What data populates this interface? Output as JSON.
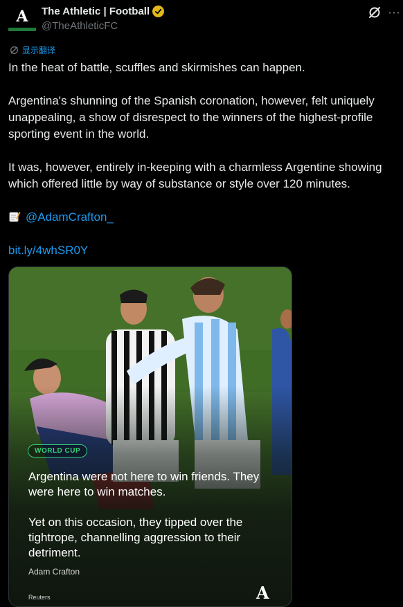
{
  "header": {
    "avatar_glyph": "A",
    "display_name": "The Athletic | Football",
    "handle": "@TheAthleticFC",
    "brand_green": "#1f7a3a",
    "verified_color": "#e2b719"
  },
  "translate": {
    "icon": "translate-icon",
    "label": "显示翻译"
  },
  "tweet": {
    "p1": "In the heat of battle, scuffles and skirmishes can happen.",
    "p2": "Argentina's shunning of the Spanish coronation, however, felt uniquely unappealing, a show of disrespect to the winners of the highest-profile sporting event in the world.",
    "p3": "It was, however, entirely in-keeping with a charmless Argentine showing which offered little by way of substance or style over 120 minutes.",
    "author_icon": "memo-emoji",
    "author_mention": "@AdamCrafton_",
    "short_link": "bit.ly/4whSR0Y"
  },
  "media": {
    "tag": "WORLD CUP",
    "quote_line1": "Argentina were not here to win friends. They were here to win matches.",
    "quote_line2": "Yet on this occasion, they tipped over the tightrope, channelling aggression to their detriment.",
    "author": "Adam Crafton",
    "photo_credit": "Reuters",
    "wordmark": "A",
    "accent": "#34d17a"
  },
  "colors": {
    "background": "#000000",
    "text": "#e7e9ea",
    "secondary": "#71767b",
    "link": "#1d9bf0"
  }
}
